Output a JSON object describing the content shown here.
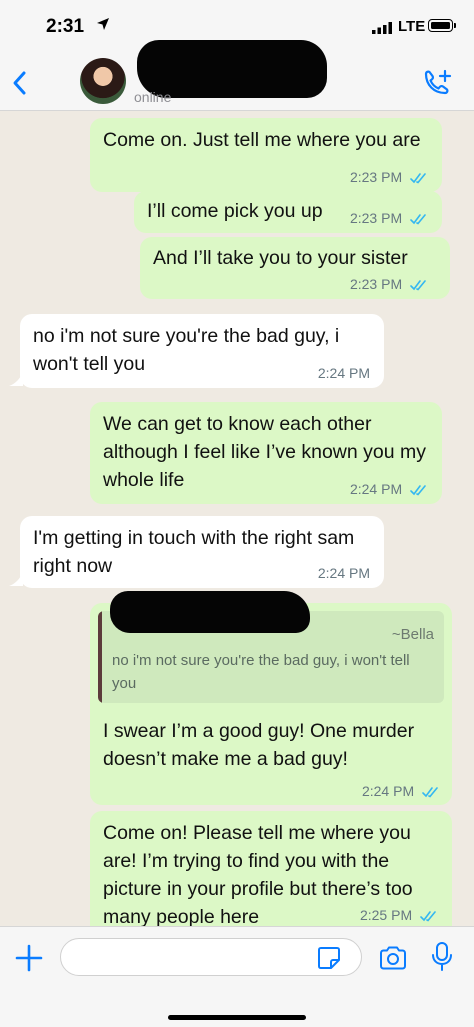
{
  "status_bar": {
    "time": "2:31",
    "network": "LTE"
  },
  "header": {
    "contact_status": "online"
  },
  "colors": {
    "accent": "#0a7cff",
    "outgoing_bubble": "#dcf8c6",
    "incoming_bubble": "#ffffff",
    "read_ticks": "#34b7f1"
  },
  "messages": [
    {
      "text": "Come on. Just tell me where you are",
      "time": "2:23 PM"
    },
    {
      "text": "I’ll come pick you up",
      "time": "2:23 PM"
    },
    {
      "text": "And I’ll take you to your sister",
      "time": "2:23 PM"
    },
    {
      "text": "no i'm not sure you're the bad guy, i won't tell you",
      "time": "2:24 PM"
    },
    {
      "text": "We can get to know each other although I feel like I’ve known you my whole life",
      "time": "2:24 PM"
    },
    {
      "text": "I'm getting in touch with the right sam right now",
      "time": "2:24 PM"
    },
    {
      "quote_sender": "~Bella",
      "quote_text": "no i'm not sure you're the bad guy, i won't tell you",
      "text": "I swear I’m a good guy! One murder doesn’t make me a bad guy!",
      "time": "2:24 PM"
    },
    {
      "text": "Come on! Please tell me where you are! I’m trying to find you with the picture in your profile but there’s too many people here",
      "time": "2:25 PM"
    }
  ],
  "input": {
    "placeholder": ""
  }
}
